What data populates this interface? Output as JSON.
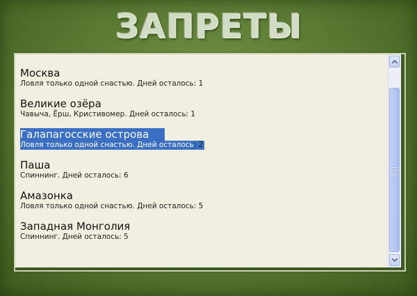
{
  "header": {
    "title": "ЗАПРЕТЫ"
  },
  "bans": [
    {
      "title": "Москва",
      "description": "Ловля только одной снастью. Дней осталось: 1",
      "selected": false
    },
    {
      "title": "Великие озёра",
      "description": "Чавыча, Ёрш, Кристивомер. Дней осталось: 1",
      "selected": false
    },
    {
      "title": "Галапагосские острова",
      "description": "Ловля только одной снастью. Дней осталось",
      "description_tail": ": 2",
      "selected": true
    },
    {
      "title": "Паша",
      "description": "Спиннинг. Дней осталось: 6",
      "selected": false
    },
    {
      "title": "Амазонка",
      "description": "Ловля только одной снастью. Дней осталось: 5",
      "selected": false
    },
    {
      "title": "Западная Монголия",
      "description": "Спиннинг. Дней осталось: 5",
      "selected": false
    }
  ],
  "scrollbar": {
    "up_icon": "arrow-up-icon",
    "down_icon": "arrow-down-icon",
    "thumb_position": 0.2,
    "thumb_size": 0.85
  },
  "colors": {
    "background": "#5d7d35",
    "list_background": "#f1f0e0",
    "selection": "#3a6fc4",
    "title_text": "#d2dbc3"
  }
}
